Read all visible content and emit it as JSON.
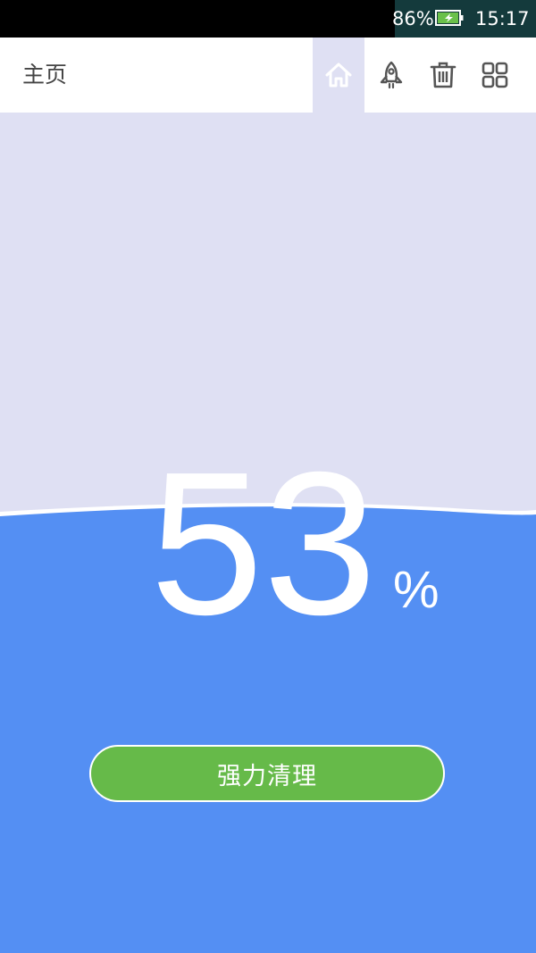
{
  "status_bar": {
    "battery_percent": "86%",
    "time": "15:17",
    "battery_icon": "battery-charging-icon"
  },
  "toolbar": {
    "title": "主页",
    "buttons": [
      {
        "name": "home",
        "icon": "home-icon",
        "active": true
      },
      {
        "name": "boost",
        "icon": "rocket-icon",
        "active": false
      },
      {
        "name": "clean",
        "icon": "trash-icon",
        "active": false
      },
      {
        "name": "apps",
        "icon": "grid-icon",
        "active": false
      }
    ]
  },
  "memory": {
    "value": "53",
    "unit": "%"
  },
  "action": {
    "label": "强力清理"
  },
  "colors": {
    "background": "#dfe0f3",
    "water": "#548ff3",
    "button": "#66ba49"
  }
}
